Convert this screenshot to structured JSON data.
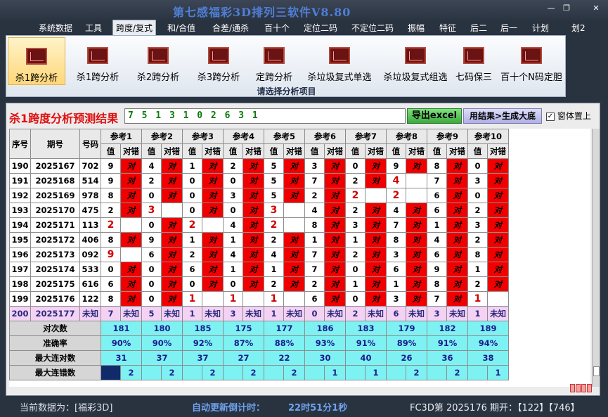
{
  "app": {
    "title": "第七感福彩3D排列三软件V8.80"
  },
  "window": {
    "minimize": "—",
    "restore": "❐",
    "close": "✕"
  },
  "menu": [
    "系统数据",
    "工具",
    "跨度/复式",
    "和/合值",
    "合差/通杀",
    "百十个",
    "定位二码",
    "不定位二码",
    "振幅",
    "特征",
    "后二",
    "后一",
    "计划",
    "划2"
  ],
  "menu_active": "跨度/复式",
  "ribbon": {
    "buttons": [
      "杀1跨分析",
      "杀1跨分析",
      "杀2跨分析",
      "杀3跨分析",
      "定跨分析",
      "杀垃圾复式单选",
      "杀垃圾复式组选",
      "七码保三",
      "百十个N码定胆"
    ],
    "selected_index": 0,
    "group_label": "请选择分析项目"
  },
  "result": {
    "label": "杀1跨度分析预测结果",
    "value": "7 5 1 3 1 0 2 6 3 1",
    "excel_button": "导出excel",
    "generate_button": "用结果>生成大底",
    "topmost_label": "窗体置上",
    "topmost_checked": "✓"
  },
  "table": {
    "headers": {
      "seq": "序号",
      "period": "期号",
      "code": "号码",
      "value": "值",
      "check": "对错"
    },
    "refs": [
      "参考1",
      "参考2",
      "参考3",
      "参考4",
      "参考5",
      "参考6",
      "参考7",
      "参考8",
      "参考9",
      "参考10"
    ],
    "ok_text": "对",
    "unknown_text": "未知",
    "rows": [
      {
        "seq": "190",
        "period": "2025167",
        "code": "702",
        "cells": [
          [
            "9",
            1
          ],
          [
            "4",
            1
          ],
          [
            "1",
            1
          ],
          [
            "2",
            1
          ],
          [
            "5",
            1
          ],
          [
            "3",
            1
          ],
          [
            "0",
            1
          ],
          [
            "9",
            1
          ],
          [
            "8",
            1
          ],
          [
            "0",
            1
          ]
        ]
      },
      {
        "seq": "191",
        "period": "2025168",
        "code": "514",
        "cells": [
          [
            "9",
            1
          ],
          [
            "2",
            1
          ],
          [
            "0",
            1
          ],
          [
            "0",
            1
          ],
          [
            "5",
            1
          ],
          [
            "7",
            1
          ],
          [
            "2",
            1
          ],
          [
            "4",
            0
          ],
          [
            "7",
            1
          ],
          [
            "3",
            1
          ]
        ]
      },
      {
        "seq": "192",
        "period": "2025169",
        "code": "978",
        "cells": [
          [
            "8",
            1
          ],
          [
            "0",
            1
          ],
          [
            "0",
            1
          ],
          [
            "3",
            1
          ],
          [
            "5",
            1
          ],
          [
            "2",
            1
          ],
          [
            "2",
            0
          ],
          [
            "2",
            0
          ],
          [
            "6",
            1
          ],
          [
            "0",
            1
          ]
        ]
      },
      {
        "seq": "193",
        "period": "2025170",
        "code": "475",
        "cells": [
          [
            "2",
            1
          ],
          [
            "3",
            0
          ],
          [
            "0",
            1
          ],
          [
            "0",
            1
          ],
          [
            "3",
            0
          ],
          [
            "4",
            1
          ],
          [
            "2",
            1
          ],
          [
            "4",
            1
          ],
          [
            "6",
            1
          ],
          [
            "2",
            1
          ]
        ]
      },
      {
        "seq": "194",
        "period": "2025171",
        "code": "113",
        "cells": [
          [
            "2",
            0
          ],
          [
            "0",
            1
          ],
          [
            "2",
            0
          ],
          [
            "4",
            1
          ],
          [
            "2",
            0
          ],
          [
            "8",
            1
          ],
          [
            "3",
            1
          ],
          [
            "7",
            1
          ],
          [
            "1",
            1
          ],
          [
            "3",
            1
          ]
        ]
      },
      {
        "seq": "195",
        "period": "2025172",
        "code": "406",
        "cells": [
          [
            "8",
            1
          ],
          [
            "9",
            1
          ],
          [
            "1",
            1
          ],
          [
            "1",
            1
          ],
          [
            "2",
            1
          ],
          [
            "1",
            1
          ],
          [
            "1",
            1
          ],
          [
            "8",
            1
          ],
          [
            "4",
            1
          ],
          [
            "2",
            1
          ]
        ]
      },
      {
        "seq": "196",
        "period": "2025173",
        "code": "092",
        "cells": [
          [
            "9",
            0
          ],
          [
            "6",
            1
          ],
          [
            "2",
            1
          ],
          [
            "4",
            1
          ],
          [
            "4",
            1
          ],
          [
            "7",
            1
          ],
          [
            "2",
            1
          ],
          [
            "3",
            1
          ],
          [
            "6",
            1
          ],
          [
            "8",
            1
          ]
        ]
      },
      {
        "seq": "197",
        "period": "2025174",
        "code": "533",
        "cells": [
          [
            "0",
            1
          ],
          [
            "0",
            1
          ],
          [
            "6",
            1
          ],
          [
            "1",
            1
          ],
          [
            "1",
            1
          ],
          [
            "7",
            1
          ],
          [
            "0",
            1
          ],
          [
            "6",
            1
          ],
          [
            "9",
            1
          ],
          [
            "1",
            1
          ]
        ]
      },
      {
        "seq": "198",
        "period": "2025175",
        "code": "616",
        "cells": [
          [
            "6",
            1
          ],
          [
            "0",
            1
          ],
          [
            "0",
            1
          ],
          [
            "0",
            1
          ],
          [
            "2",
            1
          ],
          [
            "2",
            1
          ],
          [
            "1",
            1
          ],
          [
            "1",
            1
          ],
          [
            "8",
            1
          ],
          [
            "2",
            1
          ]
        ]
      },
      {
        "seq": "199",
        "period": "2025176",
        "code": "122",
        "cells": [
          [
            "8",
            1
          ],
          [
            "0",
            1
          ],
          [
            "1",
            0
          ],
          [
            "1",
            0
          ],
          [
            "1",
            0
          ],
          [
            "6",
            1
          ],
          [
            "0",
            1
          ],
          [
            "3",
            1
          ],
          [
            "7",
            1
          ],
          [
            "1",
            0
          ]
        ]
      }
    ],
    "predict_row": {
      "seq": "200",
      "period": "2025177",
      "code": "未知",
      "values": [
        "7",
        "5",
        "1",
        "3",
        "1",
        "0",
        "2",
        "6",
        "3",
        "1"
      ]
    },
    "stats": [
      {
        "label": "对次数",
        "values": [
          "181",
          "180",
          "185",
          "175",
          "177",
          "186",
          "183",
          "179",
          "182",
          "189"
        ]
      },
      {
        "label": "准确率",
        "values": [
          "90%",
          "90%",
          "92%",
          "87%",
          "88%",
          "93%",
          "91%",
          "89%",
          "91%",
          "94%"
        ]
      },
      {
        "label": "最大连对数",
        "values": [
          "31",
          "37",
          "37",
          "27",
          "22",
          "30",
          "40",
          "26",
          "36",
          "38"
        ]
      },
      {
        "label": "最大连错数",
        "values": [
          "2",
          "2",
          "2",
          "2",
          "2",
          "1",
          "1",
          "2",
          "2",
          "1"
        ]
      }
    ]
  },
  "status": {
    "current_data": "当前数据为：[福彩3D]",
    "countdown_label": "自动更新倒计时：",
    "countdown": "22时51分1秒",
    "draw_info": "FC3D第 2025176 期开：【122】【746】"
  },
  "colors": {
    "ok": "#f00000",
    "predict_row": "#f4d2f4",
    "stats": "#7ef2f2",
    "title": "#4f7fd6",
    "result_label": "#e01010"
  }
}
